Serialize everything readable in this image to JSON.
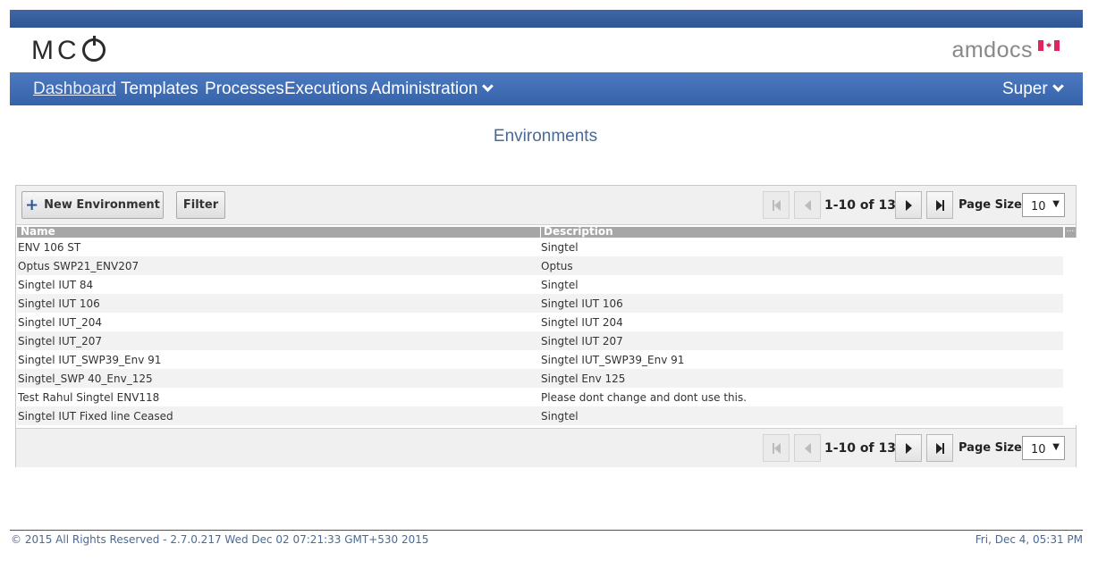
{
  "header": {
    "logo_text": "MC",
    "brand": "amdocs",
    "flag_icon": "canada-flag-icon"
  },
  "nav": {
    "dashboard": "Dashboard",
    "templates": "Templates",
    "processes": "Processes",
    "executions": "Executions",
    "administration": "Administration",
    "user": "Super"
  },
  "page": {
    "title": "Environments"
  },
  "toolbar": {
    "new_environment": "New Environment",
    "filter": "Filter",
    "page_info": "1-10 of 13",
    "page_size_label": "Page Size:",
    "page_size_value": "10"
  },
  "grid": {
    "columns": [
      "Name",
      "Description"
    ],
    "rows": [
      {
        "name": "ENV 106 ST",
        "description": "Singtel"
      },
      {
        "name": "Optus SWP21_ENV207",
        "description": "Optus"
      },
      {
        "name": "Singtel IUT 84",
        "description": "Singtel"
      },
      {
        "name": "Singtel IUT 106",
        "description": "Singtel IUT 106"
      },
      {
        "name": "Singtel IUT_204",
        "description": "Singtel IUT 204"
      },
      {
        "name": "Singtel IUT_207",
        "description": "Singtel IUT 207"
      },
      {
        "name": "Singtel IUT_SWP39_Env 91",
        "description": "Singtel IUT_SWP39_Env 91"
      },
      {
        "name": "Singtel_SWP 40_Env_125",
        "description": "Singtel Env 125"
      },
      {
        "name": "Test Rahul Singtel ENV118",
        "description": "Please dont change and dont use this."
      },
      {
        "name": "Singtel IUT Fixed line Ceased",
        "description": "Singtel"
      }
    ]
  },
  "footer": {
    "left": "© 2015 All Rights Reserved - 2.7.0.217 Wed Dec 02 07:21:33 GMT+530 2015",
    "right": "Fri, Dec 4, 05:31 PM"
  },
  "colors": {
    "nav_bg": "#3a67b0",
    "accent_text": "#4a6a95"
  }
}
